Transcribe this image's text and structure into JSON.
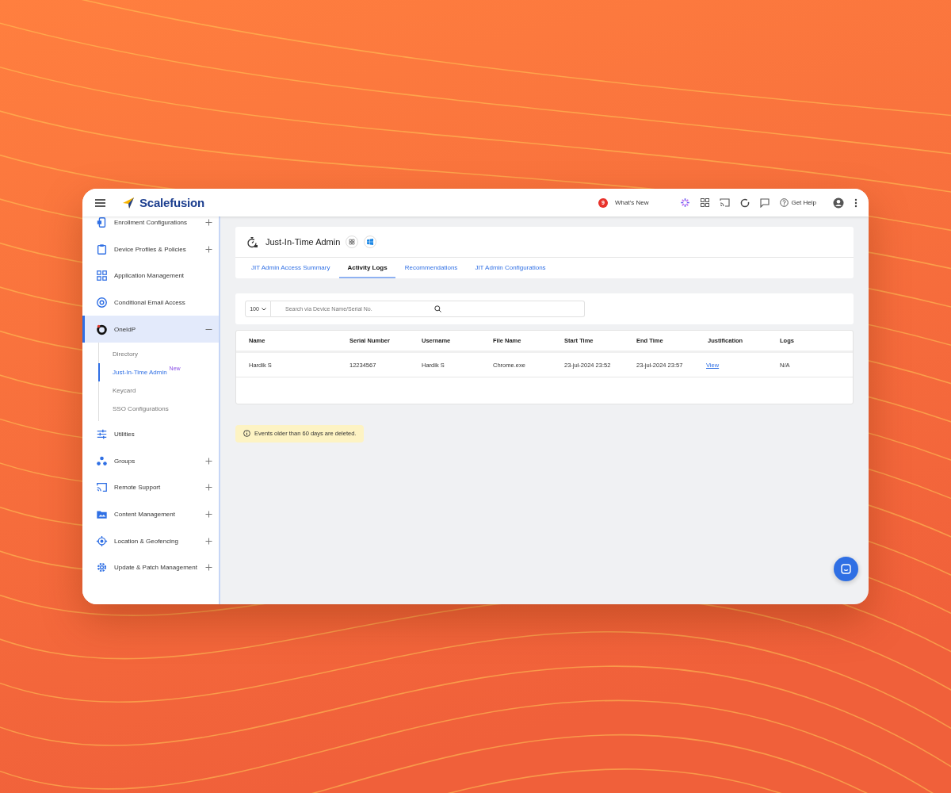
{
  "topbar": {
    "brand": "Scalefusion",
    "whats_new": {
      "badge": "9",
      "label": "What's New"
    },
    "help": "Get Help"
  },
  "sidebar": {
    "items": [
      {
        "label": "Enrollment Configurations",
        "selected": false,
        "expanded": false
      },
      {
        "label": "Device Profiles & Policies",
        "selected": false,
        "expanded": false
      },
      {
        "label": "Application Management",
        "selected": false
      },
      {
        "label": "Conditional Email Access",
        "selected": false
      },
      {
        "label": "OneIdP",
        "selected": true,
        "expanded": true,
        "children": [
          {
            "label": "Directory",
            "selected": false
          },
          {
            "label": "Just-In-Time Admin",
            "selected": true,
            "badge": "New"
          },
          {
            "label": "Keycard",
            "selected": false
          },
          {
            "label": "SSO Configurations",
            "selected": false
          }
        ]
      },
      {
        "label": "Utilities",
        "selected": false
      },
      {
        "label": "Groups",
        "selected": false,
        "expanded": false
      },
      {
        "label": "Remote Support",
        "selected": false,
        "expanded": false
      },
      {
        "label": "Content Management",
        "selected": false,
        "expanded": false
      },
      {
        "label": "Location & Geofencing",
        "selected": false,
        "expanded": false
      },
      {
        "label": "Update & Patch Management",
        "selected": false,
        "expanded": false
      }
    ]
  },
  "page": {
    "title": "Just-In-Time Admin",
    "tabs": [
      {
        "label": "JIT Admin Access Summary",
        "selected": false
      },
      {
        "label": "Activity Logs",
        "selected": true
      },
      {
        "label": "Recommendations",
        "selected": false
      },
      {
        "label": "JIT Admin Configurations",
        "selected": false
      }
    ],
    "page_size": "100",
    "search": {
      "placeholder": "Search via Device Name/Serial No."
    },
    "table": {
      "columns": [
        "Name",
        "Serial Number",
        "Username",
        "File Name",
        "Start Time",
        "End Time",
        "Justification",
        "Logs"
      ],
      "rows": [
        {
          "cells": [
            "Hardik S",
            "12234567",
            "Hardik S",
            "Chrome.exe",
            "23-jul-2024 23:52",
            "23-jul-2024 23:57",
            "View",
            "N/A"
          ]
        }
      ]
    },
    "notice": "Events older than 60 days are deleted."
  }
}
